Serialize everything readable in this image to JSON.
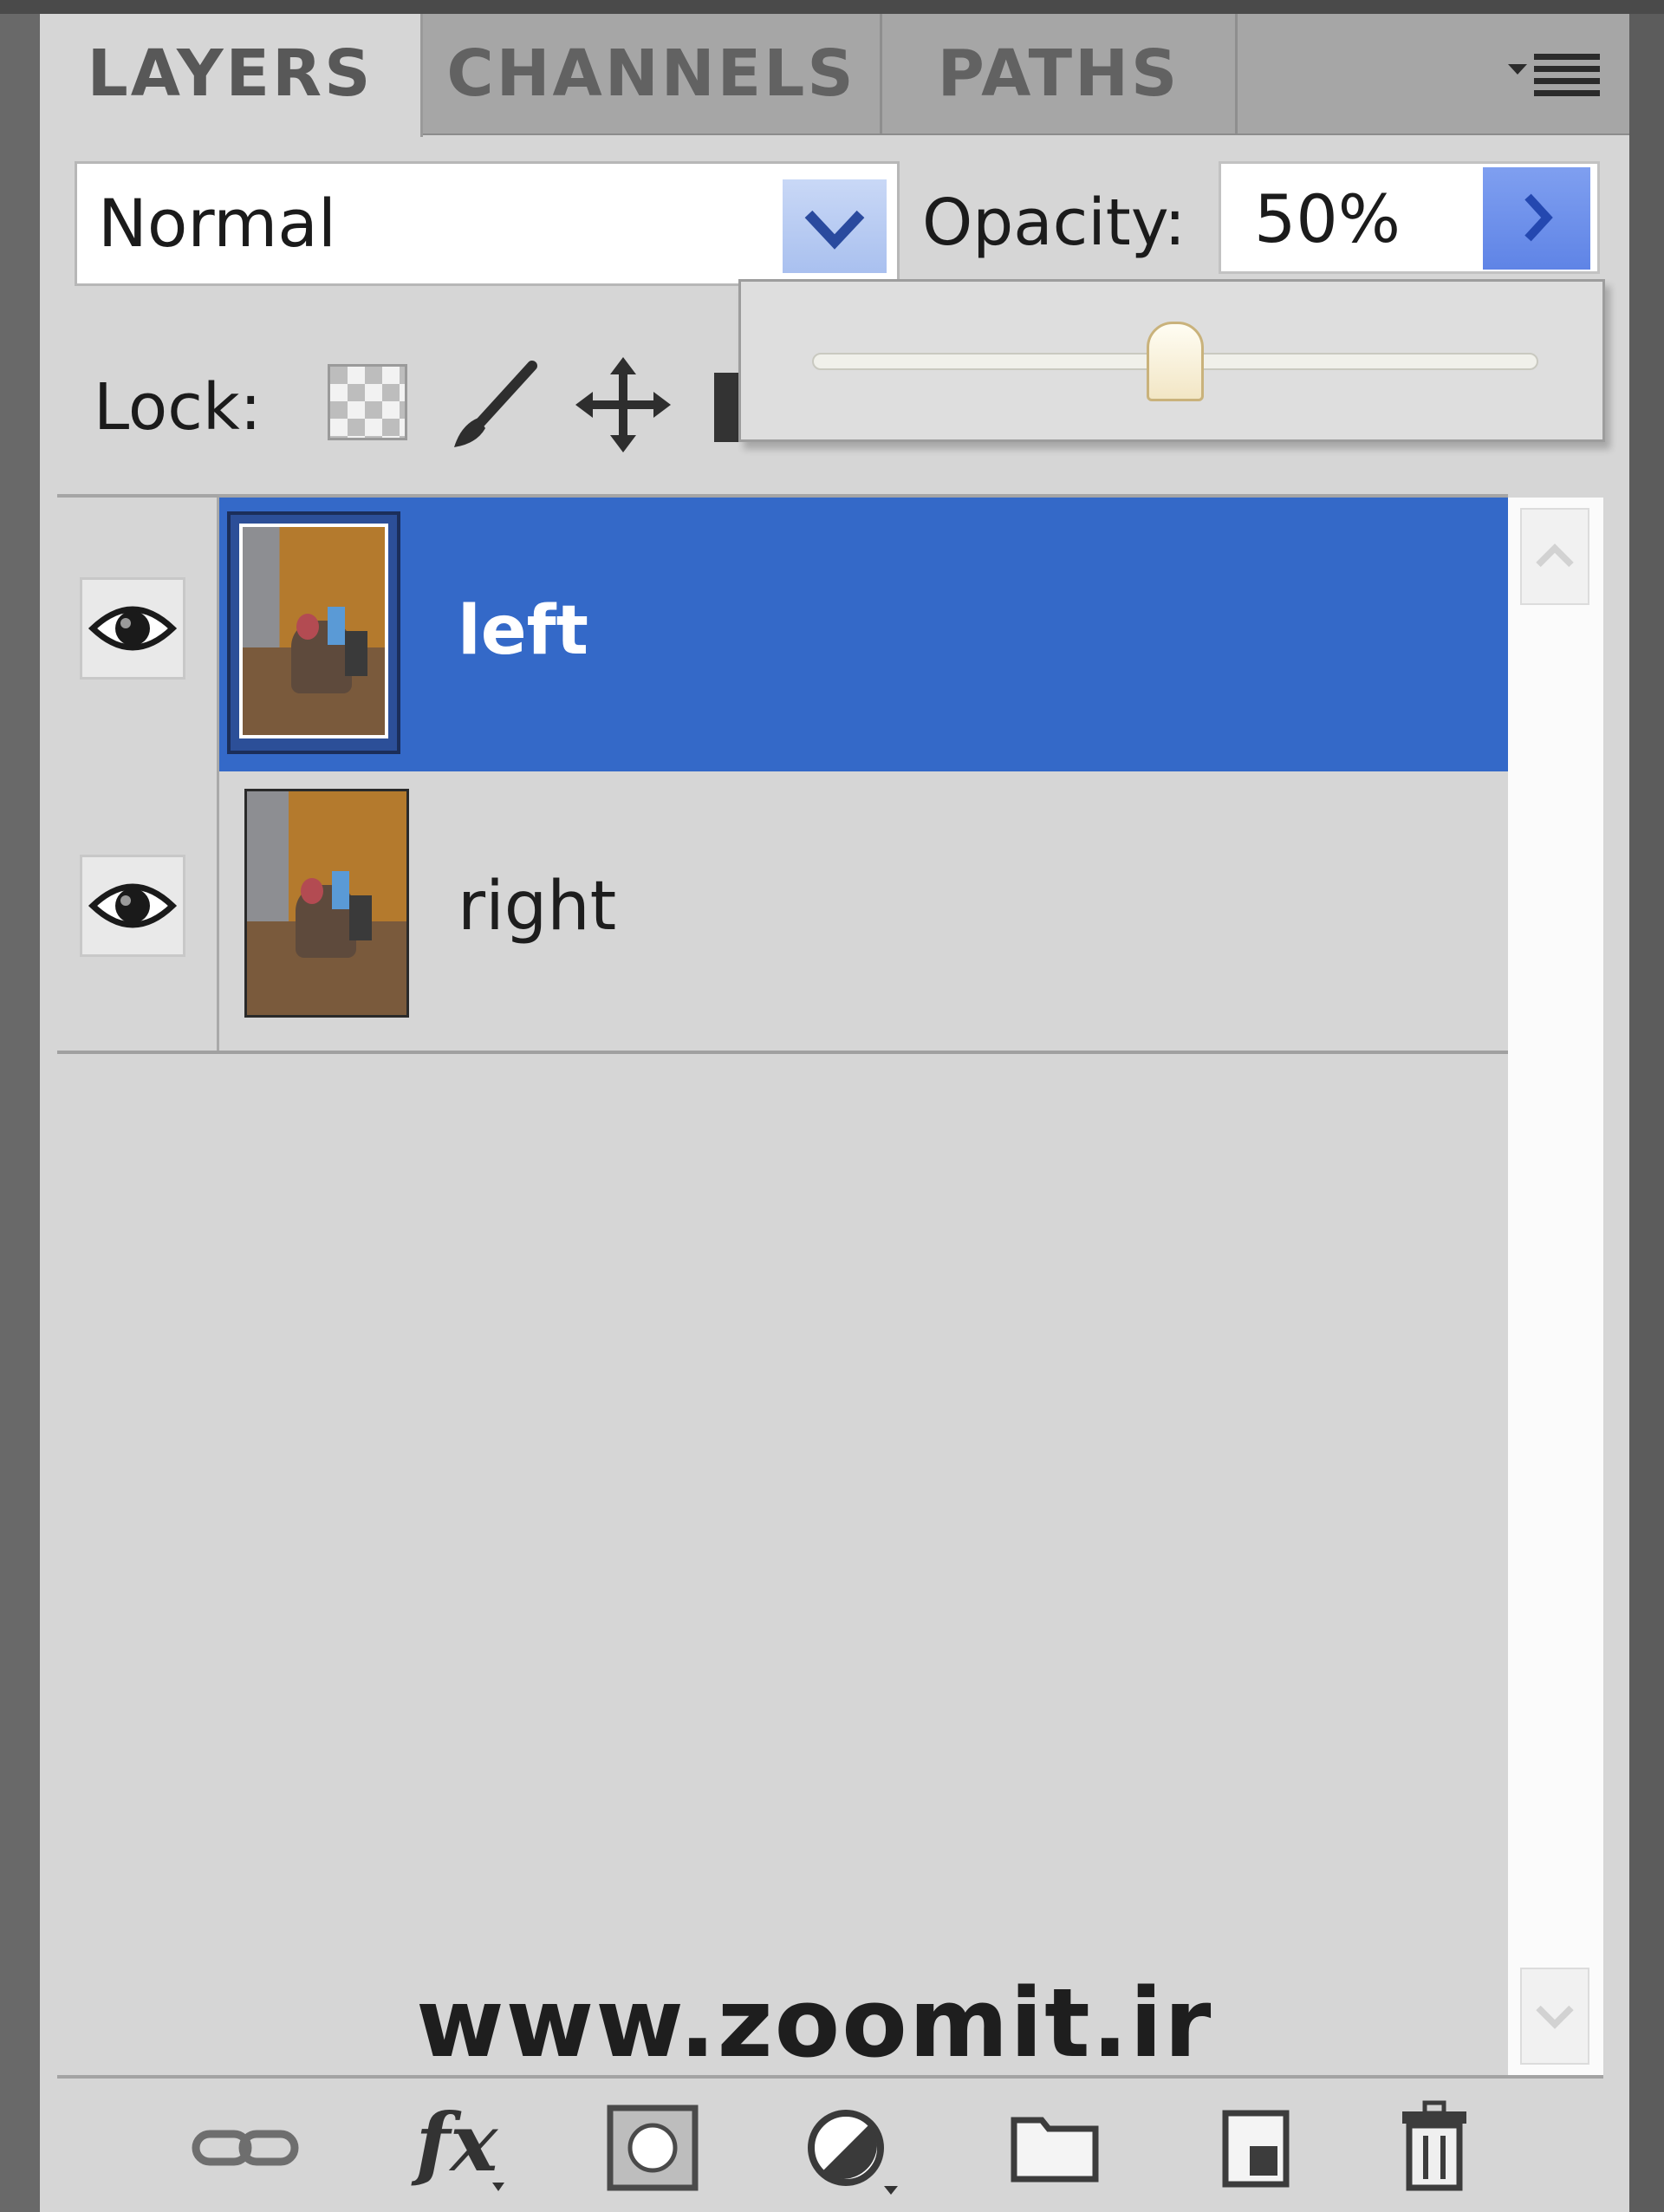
{
  "tabs": [
    {
      "label": "LAYERS",
      "active": true
    },
    {
      "label": "CHANNELS",
      "active": false
    },
    {
      "label": "PATHS",
      "active": false
    }
  ],
  "blend_mode": {
    "value": "Normal"
  },
  "opacity": {
    "label": "Opacity:",
    "value": "50%",
    "slider_fraction": 0.5
  },
  "lock": {
    "label": "Lock:"
  },
  "layers": [
    {
      "name": "left",
      "selected": true,
      "visible": true
    },
    {
      "name": "right",
      "selected": false,
      "visible": true
    }
  ],
  "watermark": "www.zoomit.ir",
  "colors": {
    "selection": "#3469c8",
    "panel_bg": "#d6d6d6",
    "arrow_button": "#6a8ef0"
  },
  "icons": {
    "panel_menu": "panel-menu-icon",
    "eye": "eye-icon",
    "link": "link-layers-icon",
    "fx": "layer-style-icon",
    "mask": "add-mask-icon",
    "adjustment": "adjustment-layer-icon",
    "group": "folder-icon",
    "new_layer": "new-layer-icon",
    "delete": "trash-icon"
  }
}
